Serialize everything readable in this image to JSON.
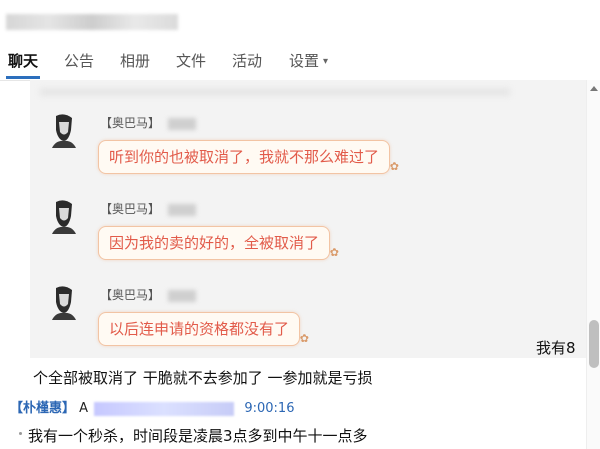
{
  "tabs": [
    "聊天",
    "公告",
    "相册",
    "文件",
    "活动",
    "设置"
  ],
  "image": {
    "messages": [
      {
        "sender": "【奥巴马】",
        "text": "听到你的也被取消了，我就不那么难过了"
      },
      {
        "sender": "【奥巴马】",
        "text": "因为我的卖的好的，全被取消了"
      },
      {
        "sender": "【奥巴马】",
        "text": "以后连申请的资格都没有了"
      }
    ]
  },
  "chat": {
    "right_fragment": "我有8",
    "line1": "个全部被取消了 干脆就不去参加了 一参加就是亏损",
    "sender_name": "【朴槿惠】",
    "sender_ident_letter": "A",
    "time": "9:00:16",
    "line2": "我有一个秒杀，时间段是凌晨3点多到中午十一点多"
  },
  "colors": {
    "tab_underline": "#2c6fbd",
    "bubble_text": "#e25b4a",
    "bubble_border": "#f2c4a4",
    "sender_name": "#2c67b4"
  }
}
